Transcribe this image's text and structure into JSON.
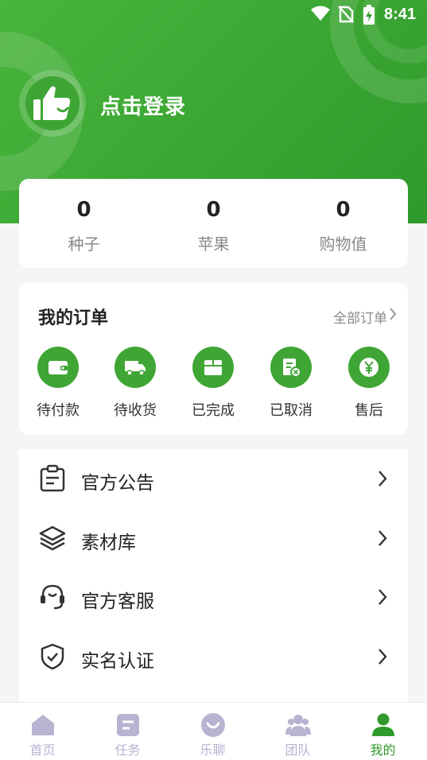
{
  "status": {
    "time": "8:41"
  },
  "profile": {
    "login_text": "点击登录"
  },
  "stats": [
    {
      "value": "0",
      "label": "种子"
    },
    {
      "value": "0",
      "label": "苹果"
    },
    {
      "value": "0",
      "label": "购物值"
    }
  ],
  "orders": {
    "title": "我的订单",
    "all_label": "全部订单",
    "items": [
      {
        "label": "待付款",
        "icon": "wallet-icon"
      },
      {
        "label": "待收货",
        "icon": "truck-icon"
      },
      {
        "label": "已完成",
        "icon": "box-icon"
      },
      {
        "label": "已取消",
        "icon": "cancel-receipt-icon"
      },
      {
        "label": "售后",
        "icon": "yen-icon"
      }
    ]
  },
  "menu": [
    {
      "label": "官方公告",
      "icon": "clipboard-icon"
    },
    {
      "label": "素材库",
      "icon": "layers-icon"
    },
    {
      "label": "官方客服",
      "icon": "headset-icon"
    },
    {
      "label": "实名认证",
      "icon": "shield-check-icon"
    }
  ],
  "tabs": [
    {
      "label": "首页",
      "icon": "home-icon",
      "active": false
    },
    {
      "label": "任务",
      "icon": "task-icon",
      "active": false
    },
    {
      "label": "乐聊",
      "icon": "chat-face-icon",
      "active": false
    },
    {
      "label": "团队",
      "icon": "team-icon",
      "active": false
    },
    {
      "label": "我的",
      "icon": "user-icon",
      "active": true
    }
  ],
  "colors": {
    "brand_green": "#3fa535",
    "tab_inactive": "#b7b4d2"
  }
}
